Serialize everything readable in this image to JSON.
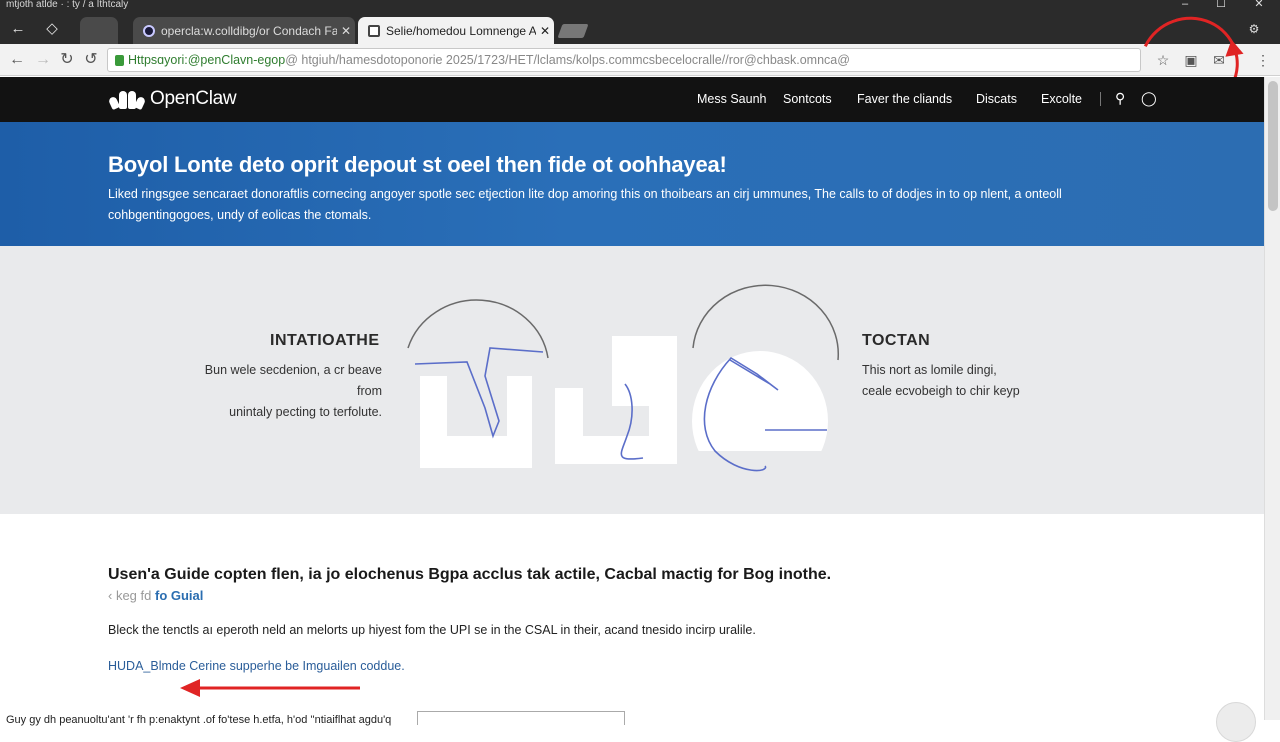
{
  "window": {
    "title": "mtjoth atlde · : ty / a Ithtcaly",
    "controls": [
      "–",
      "☐",
      "✕"
    ]
  },
  "tabs": [
    {
      "title": "opercla:w.colldibg/or Condach Faus",
      "close": "✕",
      "active": false
    },
    {
      "title": "Selie/homedou Lomnenge At",
      "close": "✕",
      "active": true
    }
  ],
  "toolbar": {
    "url_host": "Httpsɑyori:@penClavn-egop",
    "url_rest": " @ htgiuh/hamesdotoponorie 2025/1723/HET/lclams/kolps.commcsbecelocralle//ror@chbask.omnca@",
    "colors": {
      "secure": "#2f7d2f"
    }
  },
  "site": {
    "logo_text": "OpenClaw",
    "nav": [
      "Mess Saunh",
      "Sontcots",
      "Faver the cliands",
      "Discats",
      "Excolte"
    ]
  },
  "hero": {
    "headline": "Boyol Lonte deto oprit depout st oeel then fide ot oohhayea!",
    "body": "Liked ringsɡee sencaraet donoraftlis cornecing angoyer spotle sec etjection lite dop amoring this on thoibears an cirj ummunes, The calls to of dodjes in to op nlent, a onteoll cohbgentingogoes, undy of eolicas the ctomals."
  },
  "illustration": {
    "left_title": "INTATIOATHE",
    "left_desc_1": "Bun wele secdenion, a cr beave from",
    "left_desc_2": "unintaly pecting to terfolute.",
    "right_title": "TOCTAN",
    "right_desc_1": "This nort as lomile dingi,",
    "right_desc_2": "ceale ecvobeigh to chir keyp"
  },
  "guide": {
    "heading": "Usen'a Guide copten flen, ia jo elochenus Bgpa acclus tak actile, Cacbal mactig for Bog inothe.",
    "link_prefix": "‹ keg fd",
    "link_text": "fo Guial",
    "paragraph": "Bleck the tenctls aı eperoth neld an melorts up hiyest fom the UPI se in the CSAL in their, acand tnesido incirp uralile.",
    "code_line": "HUDA_Blmde Cerine supperhe be Imguailen coddue.",
    "bottom_line": "Guy gy dh peanuoltu'ant 'r fh p:enaktynt .of fo'tese h.etfa, h'od ''ntiaiflhat agdu'q"
  }
}
